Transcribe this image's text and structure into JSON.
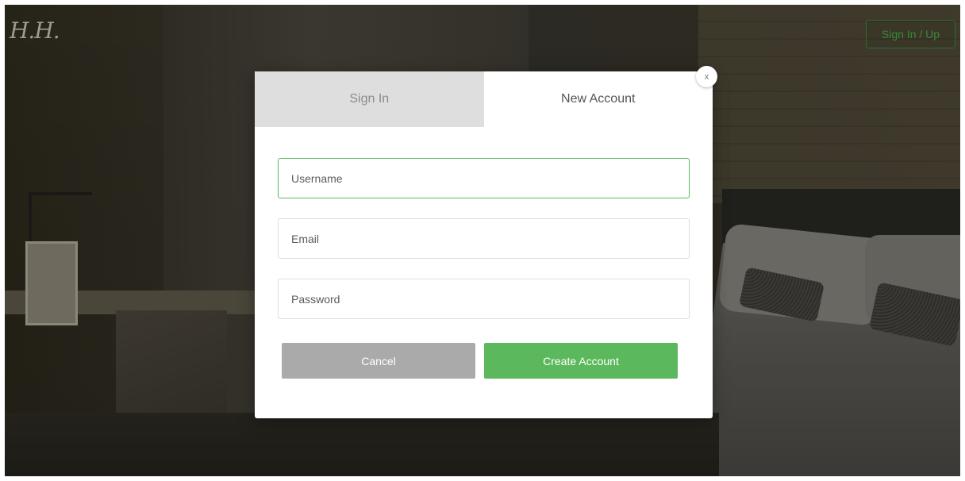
{
  "header": {
    "logo_text": "H.H.",
    "auth_button_label": "Sign In / Up"
  },
  "modal": {
    "close_label": "x",
    "tabs": [
      {
        "label": "Sign In",
        "active": false
      },
      {
        "label": "New Account",
        "active": true
      }
    ],
    "fields": {
      "username_placeholder": "Username",
      "email_placeholder": "Email",
      "password_placeholder": "Password"
    },
    "buttons": {
      "cancel_label": "Cancel",
      "create_label": "Create Account"
    }
  },
  "colors": {
    "accent_green": "#5cb85c",
    "cancel_gray": "#aaaaaa",
    "inactive_tab": "#dedede"
  }
}
